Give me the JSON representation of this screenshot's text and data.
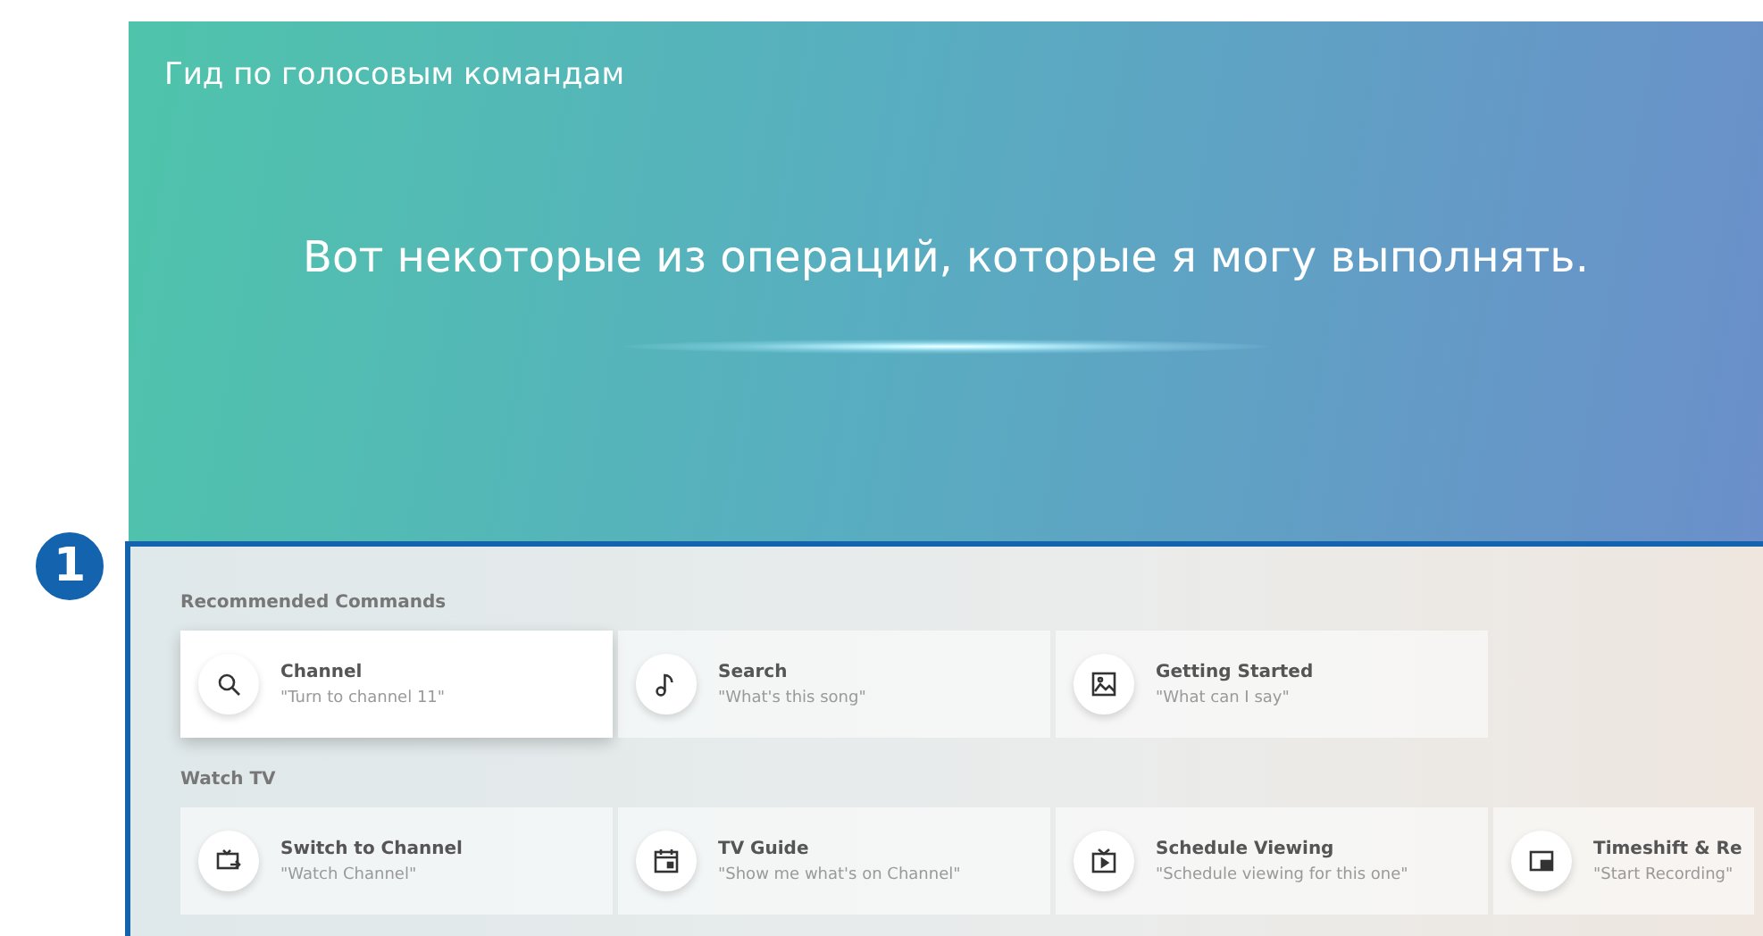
{
  "header": {
    "title": "Гид по голосовым командам",
    "message": "Вот некоторые из операций, которые я могу выполнять."
  },
  "callout": {
    "number": "1"
  },
  "sections": [
    {
      "title": "Recommended Commands",
      "commands": [
        {
          "kind": "search",
          "title": "Channel",
          "example": "\"Turn to channel 11\"",
          "selected": true
        },
        {
          "kind": "music",
          "title": "Search",
          "example": "\"What's this song\"",
          "selected": false
        },
        {
          "kind": "image",
          "title": "Getting Started",
          "example": "\"What can I say\"",
          "selected": false
        }
      ]
    },
    {
      "title": "Watch TV",
      "commands": [
        {
          "kind": "switch",
          "title": "Switch to Channel",
          "example": "\"Watch Channel\"",
          "selected": false
        },
        {
          "kind": "calendar",
          "title": "TV Guide",
          "example": "\"Show me what's on Channel\"",
          "selected": false
        },
        {
          "kind": "tv",
          "title": "Schedule Viewing",
          "example": "\"Schedule viewing for this one\"",
          "selected": false
        },
        {
          "kind": "pip",
          "title": "Timeshift & Re",
          "example": "\"Start Recording\"",
          "selected": false
        }
      ]
    }
  ]
}
